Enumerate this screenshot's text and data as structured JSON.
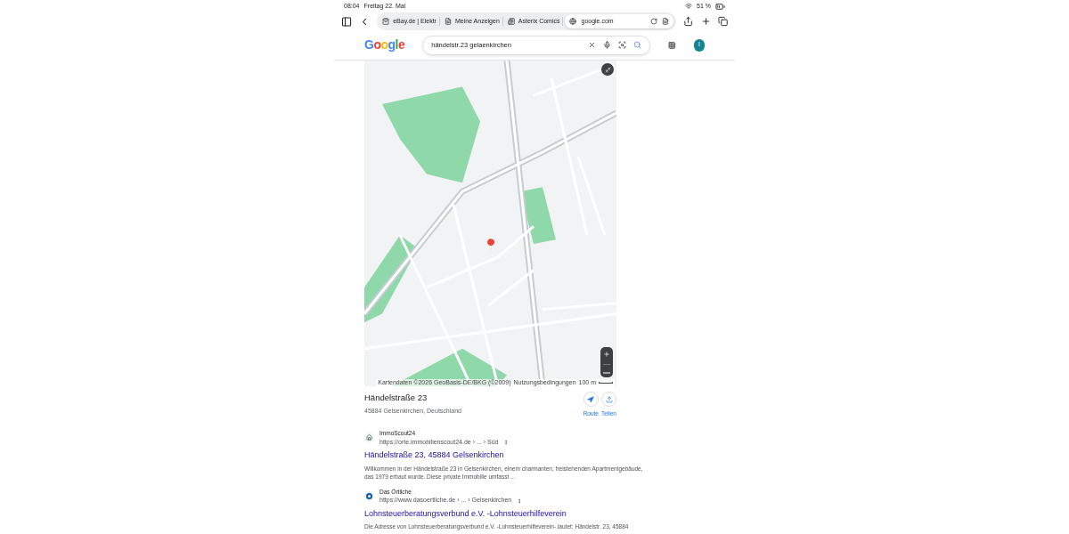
{
  "status_bar": {
    "time": "08:04",
    "date": "Freitag 22. Mai",
    "battery": "51 %"
  },
  "tabs": [
    {
      "label": "eBay.de | Elektr",
      "selected": false
    },
    {
      "label": "Meine Anzeigen",
      "selected": false
    },
    {
      "label": "Asterix Comics",
      "selected": false
    },
    {
      "label": "google.com",
      "selected": true
    }
  ],
  "google": {
    "logo": "Google",
    "query": "händelstr.23 gelaenkirchen",
    "avatar": "I"
  },
  "map": {
    "attribution": "Kartendaten ©2026 GeoBasis-DE/BKG (©2009)",
    "terms": "Nutzungsbedingungen",
    "scale": "100 m"
  },
  "place": {
    "name": "Händelstraße 23",
    "address": "45884 Gelsenkirchen, Deutschland",
    "actions": [
      {
        "kind": "route",
        "label": "Route"
      },
      {
        "kind": "share",
        "label": "Teilen"
      }
    ]
  },
  "results": [
    {
      "kind": "house",
      "source": "ImmoScout24",
      "url": "https://orte.immobilienscout24.de › ... › Süd",
      "title": "Händelstraße 23, 45884 Gelsenkirchen",
      "snippet": "Willkommen in der Händelstraße 23 in Gelsenkirchen, einem charmanten, freistehenden Apartmentgebäude, das 1979 erbaut wurde. Diese private Immobilie umfasst ..."
    },
    {
      "kind": "letter",
      "source": "Das Örtliche",
      "url": "https://www.dasoertliche.de › ... › Gelsenkirchen",
      "title": "Lohnsteuerberatungsverbund e.V. -Lohnsteuerhilfeverein",
      "snippet": "Die Adresse von Lohnsteuerberatungsverbund e.V. -Lohnsteuerhilfeverein- lautet: Händelstr. 23, 45884"
    }
  ]
}
